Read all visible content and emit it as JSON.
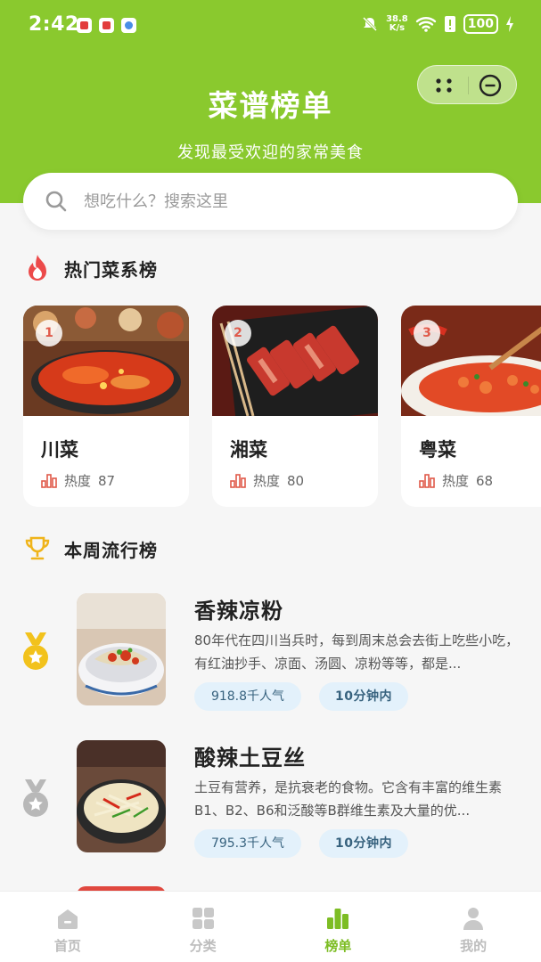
{
  "status_bar": {
    "time": "2:42",
    "net_speed_value": "38.8",
    "net_speed_unit": "K/s",
    "battery": "100"
  },
  "header": {
    "title": "菜谱榜单",
    "subtitle": "发现最受欢迎的家常美食"
  },
  "search": {
    "placeholder": "想吃什么？搜索这里"
  },
  "hot_cuisines": {
    "title": "热门菜系榜",
    "items": [
      {
        "rank": "1",
        "name": "川菜",
        "heat_label": "热度",
        "heat_value": "87"
      },
      {
        "rank": "2",
        "name": "湘菜",
        "heat_label": "热度",
        "heat_value": "80"
      },
      {
        "rank": "3",
        "name": "粤菜",
        "heat_label": "热度",
        "heat_value": "68"
      }
    ]
  },
  "weekly": {
    "title": "本周流行榜",
    "items": [
      {
        "name": "香辣凉粉",
        "desc": "80年代在四川当兵时，每到周末总会去街上吃些小吃，有红油抄手、凉面、汤圆、凉粉等等，都是...",
        "popularity": "918.8千人气",
        "time": "10分钟内",
        "medal": "gold"
      },
      {
        "name": "酸辣土豆丝",
        "desc": "土豆有营养，是抗衰老的食物。它含有丰富的维生素B1、B2、B6和泛酸等B群维生素及大量的优...",
        "popularity": "795.3千人气",
        "time": "10分钟内",
        "medal": "silver"
      }
    ]
  },
  "tabbar": {
    "items": [
      {
        "label": "首页",
        "icon": "home-icon"
      },
      {
        "label": "分类",
        "icon": "grid-icon"
      },
      {
        "label": "榜单",
        "icon": "ranking-icon",
        "active": true
      },
      {
        "label": "我的",
        "icon": "user-icon"
      }
    ]
  },
  "colors": {
    "brand_green": "#8ac92e",
    "active_tab": "#7dbd24",
    "tag_bg": "#e3f1fb",
    "rank_red": "#e05a4a"
  }
}
